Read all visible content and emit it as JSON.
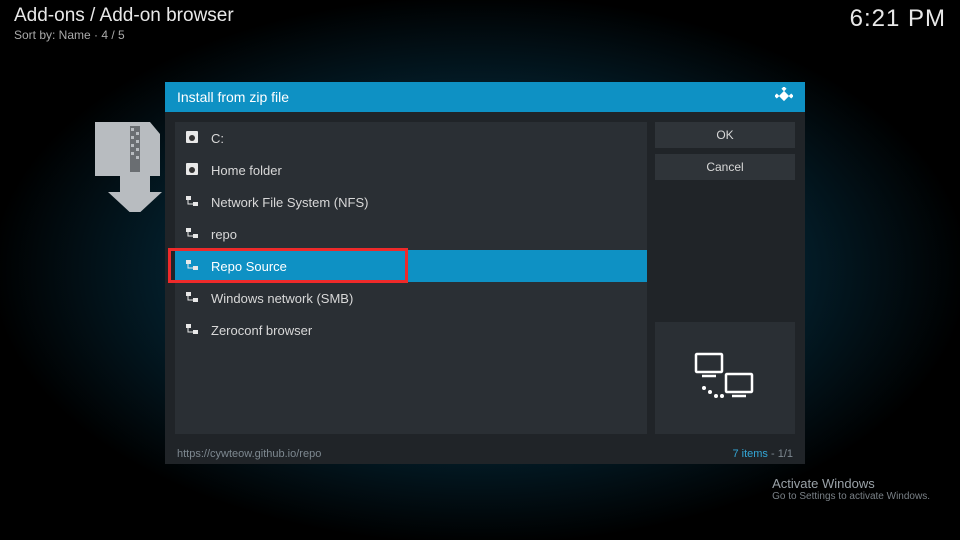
{
  "header": {
    "breadcrumb": "Add-ons / Add-on browser",
    "sort": "Sort by: Name  ·  4 / 5",
    "clock": "6:21 PM"
  },
  "dialog": {
    "title": "Install from zip file",
    "items": [
      {
        "label": "C:",
        "icon": "disk"
      },
      {
        "label": "Home folder",
        "icon": "disk"
      },
      {
        "label": "Network File System (NFS)",
        "icon": "net"
      },
      {
        "label": "repo",
        "icon": "net"
      },
      {
        "label": "Repo Source",
        "icon": "net",
        "selected": true
      },
      {
        "label": "Windows network (SMB)",
        "icon": "net"
      },
      {
        "label": "Zeroconf browser",
        "icon": "net"
      }
    ],
    "ok": "OK",
    "cancel": "Cancel",
    "footer_path": "https://cywteow.github.io/repo",
    "footer_count": "7 items",
    "footer_page": "1/1"
  },
  "watermark": {
    "line1": "Activate Windows",
    "line2": "Go to Settings to activate Windows."
  }
}
